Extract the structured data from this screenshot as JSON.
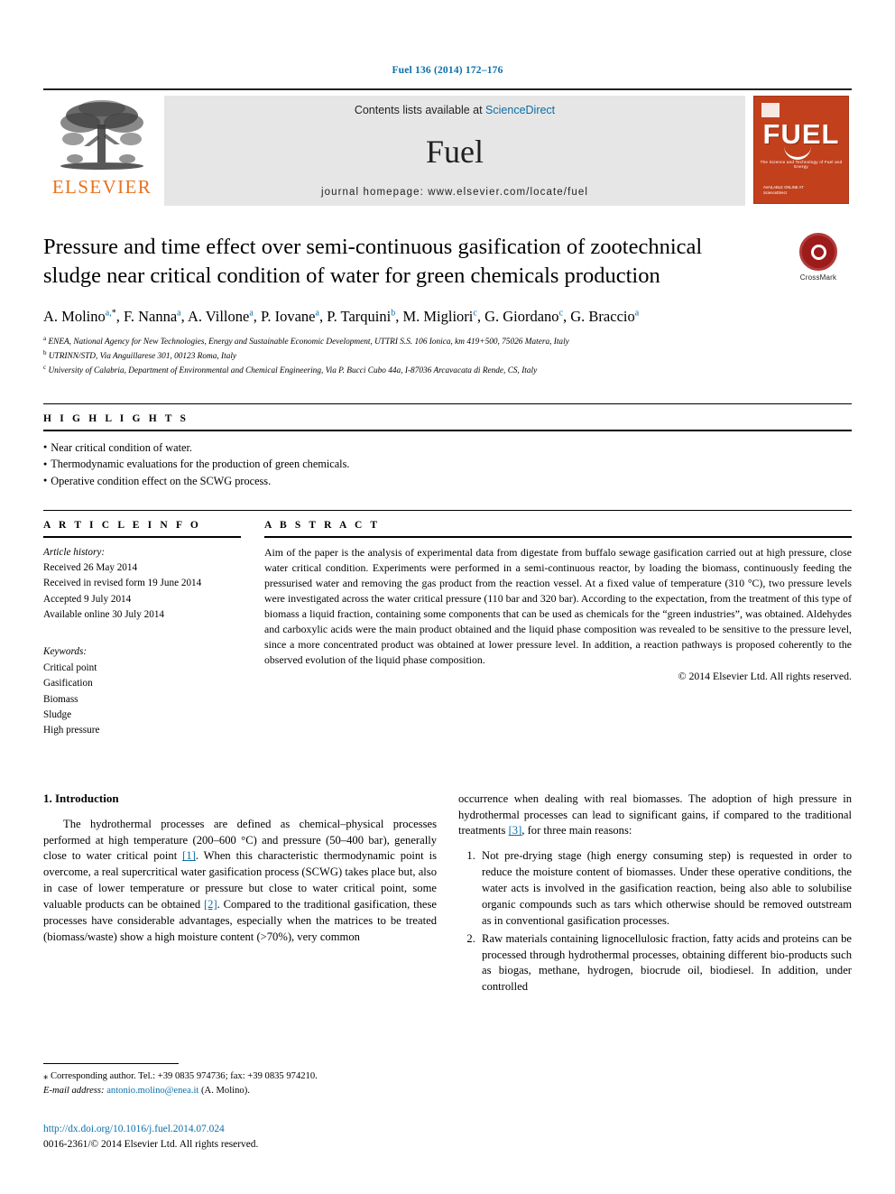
{
  "running_head": "Fuel 136 (2014) 172–176",
  "masthead": {
    "elsevier_wordmark": "ELSEVIER",
    "contents_prefix": "Contents lists available at ",
    "contents_link": "ScienceDirect",
    "journal_title": "Fuel",
    "homepage": "journal homepage: www.elsevier.com/locate/fuel",
    "cover": {
      "title": "FUEL",
      "subtitle": "The Science and Technology of Fuel and Energy",
      "bottom_line1": "AVAILABLE ONLINE AT",
      "bottom_line2": "ScienceDirect"
    }
  },
  "article": {
    "title": "Pressure and time effect over semi-continuous gasification of zootechnical sludge near critical condition of water for green chemicals production",
    "crossmark_label": "CrossMark",
    "authors": [
      {
        "name": "A. Molino",
        "sup": "a",
        "corr": true
      },
      {
        "name": "F. Nanna",
        "sup": "a"
      },
      {
        "name": "A. Villone",
        "sup": "a"
      },
      {
        "name": "P. Iovane",
        "sup": "a"
      },
      {
        "name": "P. Tarquini",
        "sup": "b"
      },
      {
        "name": "M. Migliori",
        "sup": "c"
      },
      {
        "name": "G. Giordano",
        "sup": "c"
      },
      {
        "name": "G. Braccio",
        "sup": "a"
      }
    ],
    "affiliations": [
      {
        "mark": "a",
        "text": "ENEA, National Agency for New Technologies, Energy and Sustainable Economic Development, UTTRI S.S. 106 Ionica, km 419+500, 75026 Matera, Italy"
      },
      {
        "mark": "b",
        "text": "UTRINN/STD, Via Anguillarese 301, 00123 Roma, Italy"
      },
      {
        "mark": "c",
        "text": "University of Calabria, Department of Environmental and Chemical Engineering, Via P. Bucci Cubo 44a, I-87036 Arcavacata di Rende, CS, Italy"
      }
    ]
  },
  "highlights": {
    "label": "H I G H L I G H T S",
    "items": [
      "Near critical condition of water.",
      "Thermodynamic evaluations for the production of green chemicals.",
      "Operative condition effect on the SCWG process."
    ]
  },
  "article_info": {
    "label": "A R T I C L E   I N F O",
    "history_title": "Article history:",
    "history": [
      "Received 26 May 2014",
      "Received in revised form 19 June 2014",
      "Accepted 9 July 2014",
      "Available online 30 July 2014"
    ],
    "keywords_title": "Keywords:",
    "keywords": [
      "Critical point",
      "Gasification",
      "Biomass",
      "Sludge",
      "High pressure"
    ]
  },
  "abstract": {
    "label": "A B S T R A C T",
    "text": "Aim of the paper is the analysis of experimental data from digestate from buffalo sewage gasification carried out at high pressure, close water critical condition. Experiments were performed in a semi-continuous reactor, by loading the biomass, continuously feeding the pressurised water and removing the gas product from the reaction vessel. At a fixed value of temperature (310 °C), two pressure levels were investigated across the water critical pressure (110 bar and 320 bar). According to the expectation, from the treatment of this type of biomass a liquid fraction, containing some components that can be used as chemicals for the “green industries”, was obtained. Aldehydes and carboxylic acids were the main product obtained and the liquid phase composition was revealed to be sensitive to the pressure level, since a more concentrated product was obtained at lower pressure level. In addition, a reaction pathways is proposed coherently to the observed evolution of the liquid phase composition.",
    "copyright": "© 2014 Elsevier Ltd. All rights reserved."
  },
  "introduction": {
    "heading": "1. Introduction",
    "left_para_1": "The hydrothermal processes are defined as chemical–physical processes performed at high temperature (200–600 °C) and pressure (50–400 bar), generally close to water critical point ",
    "left_ref_1": "[1]",
    "left_para_2": ". When this characteristic thermodynamic point is overcome, a real supercritical water gasification process (SCWG) takes place but, also in case of lower temperature or pressure but close to water critical point, some valuable products can be obtained ",
    "left_ref_2": "[2]",
    "left_para_3": ". Compared to the traditional gasification, these processes have considerable advantages, especially when the matrices to be treated (biomass/waste) show a high moisture content (>70%), very common",
    "right_para_1": "occurrence when dealing with real biomasses. The adoption of high pressure in hydrothermal processes can lead to significant gains, if compared to the traditional treatments ",
    "right_ref_1": "[3]",
    "right_para_2": ", for three main reasons:",
    "reasons": [
      "Not pre-drying stage (high energy consuming step) is requested in order to reduce the moisture content of biomasses. Under these operative conditions, the water acts is involved in the gasification reaction, being also able to solubilise organic compounds such as tars which otherwise should be removed outstream as in conventional gasification processes.",
      "Raw materials containing lignocellulosic fraction, fatty acids and proteins can be processed through hydrothermal processes, obtaining different bio-products such as biogas, methane, hydrogen, biocrude oil, biodiesel. In addition, under controlled"
    ]
  },
  "footnote": {
    "corresponding": "⁎ Corresponding author. Tel.: +39 0835 974736; fax: +39 0835 974210.",
    "email_label": "E-mail address:",
    "email": "antonio.molino@enea.it",
    "email_suffix": " (A. Molino)."
  },
  "imprint": {
    "doi": "http://dx.doi.org/10.1016/j.fuel.2014.07.024",
    "issn_line": "0016-2361/© 2014 Elsevier Ltd. All rights reserved."
  }
}
